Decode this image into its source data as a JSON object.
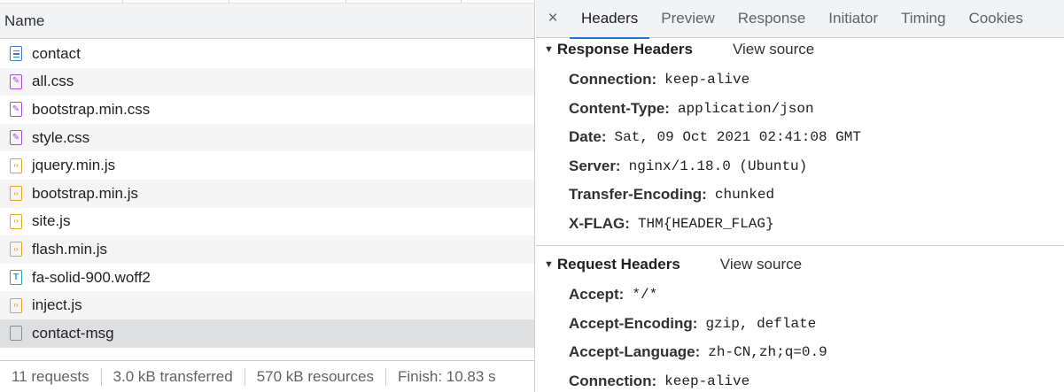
{
  "network_list": {
    "column_name": "Name",
    "requests": [
      {
        "name": "contact",
        "icon": "document-icon",
        "type": "doc"
      },
      {
        "name": "all.css",
        "icon": "stylesheet-icon",
        "type": "css"
      },
      {
        "name": "bootstrap.min.css",
        "icon": "stylesheet-icon",
        "type": "css"
      },
      {
        "name": "style.css",
        "icon": "stylesheet-icon",
        "type": "css"
      },
      {
        "name": "jquery.min.js",
        "icon": "script-icon",
        "type": "js"
      },
      {
        "name": "bootstrap.min.js",
        "icon": "script-icon",
        "type": "js"
      },
      {
        "name": "site.js",
        "icon": "script-icon",
        "type": "js"
      },
      {
        "name": "flash.min.js",
        "icon": "script-icon",
        "type": "js"
      },
      {
        "name": "fa-solid-900.woff2",
        "icon": "font-icon",
        "type": "font"
      },
      {
        "name": "inject.js",
        "icon": "script-icon",
        "type": "js"
      },
      {
        "name": "contact-msg",
        "icon": "fetch-icon",
        "type": "other",
        "selected": true
      }
    ]
  },
  "status_bar": {
    "requests": "11 requests",
    "transferred": "3.0 kB transferred",
    "resources": "570 kB resources",
    "finish": "Finish: 10.83 s"
  },
  "detail_tabs": {
    "close_glyph": "×",
    "tabs": [
      "Headers",
      "Preview",
      "Response",
      "Initiator",
      "Timing",
      "Cookies"
    ],
    "active": "Headers"
  },
  "response_headers": {
    "title": "Response Headers",
    "view_source": "View source",
    "items": [
      {
        "key": "Connection:",
        "value": "keep-alive"
      },
      {
        "key": "Content-Type:",
        "value": "application/json"
      },
      {
        "key": "Date:",
        "value": "Sat, 09 Oct 2021 02:41:08 GMT"
      },
      {
        "key": "Server:",
        "value": "nginx/1.18.0 (Ubuntu)"
      },
      {
        "key": "Transfer-Encoding:",
        "value": "chunked"
      },
      {
        "key": "X-FLAG:",
        "value": "THM{HEADER_FLAG}"
      }
    ]
  },
  "request_headers": {
    "title": "Request Headers",
    "view_source": "View source",
    "items": [
      {
        "key": "Accept:",
        "value": "*/*"
      },
      {
        "key": "Accept-Encoding:",
        "value": "gzip, deflate"
      },
      {
        "key": "Accept-Language:",
        "value": "zh-CN,zh;q=0.9"
      },
      {
        "key": "Connection:",
        "value": "keep-alive"
      }
    ]
  },
  "colors": {
    "accent": "#1a73e8",
    "doc_icon": "#3a7bd5",
    "css_icon": "#a64ad9",
    "js_icon": "#e4a51c",
    "font_icon": "#1aa6c9",
    "selected_row": "#dedfe1"
  }
}
